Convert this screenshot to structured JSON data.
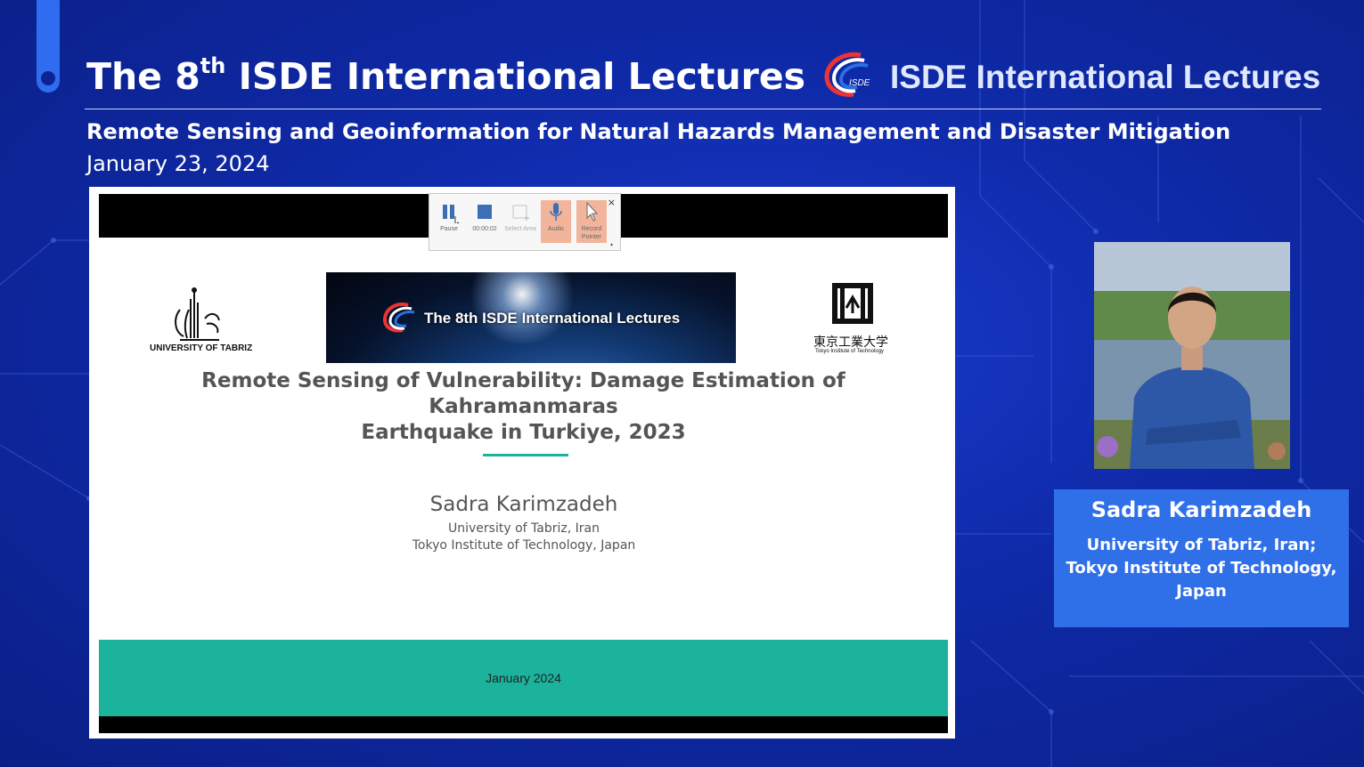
{
  "header": {
    "title_prefix": "The 8",
    "title_sup": "th",
    "title_suffix": " ISDE International Lectures",
    "brand_text": "ISDE International Lectures",
    "logo_text": "ISDE",
    "subtitle": "Remote Sensing and Geoinformation for Natural Hazards Management and Disaster Mitigation",
    "date": "January 23, 2024"
  },
  "recording_toolbar": {
    "pause_label": "Pause",
    "stop_label": "00:00:02",
    "select_area_label": "Select Area",
    "audio_label": "Audio",
    "record_pointer_label": "Record Pointer",
    "close_label": "×"
  },
  "slide": {
    "tabriz_label": "UNIVERSITY OF TABRIZ",
    "banner_text": "The 8th ISDE International Lectures",
    "tokyo_jp": "東京工業大学",
    "tokyo_en": "Tokyo Institute of Technology",
    "title_line1": "Remote Sensing of Vulnerability: Damage Estimation of Kahramanmaras",
    "title_line2": "Earthquake in Turkiye, 2023",
    "author": "Sadra Karimzadeh",
    "affiliation_line1": "University of Tabriz, Iran",
    "affiliation_line2": "Tokyo Institute of Technology, Japan",
    "footer_date": "January 2024"
  },
  "speaker": {
    "name": "Sadra Karimzadeh",
    "aff_line1": "University of Tabriz, Iran;",
    "aff_line2": "Tokyo Institute of Technology,",
    "aff_line3": "Japan"
  },
  "colors": {
    "background": "#0f2aa8",
    "accent": "#2f6cf0",
    "speaker_card": "#2f6fe8",
    "slide_teal": "#1bb39b",
    "toolbar_highlight": "#f2b59b"
  }
}
